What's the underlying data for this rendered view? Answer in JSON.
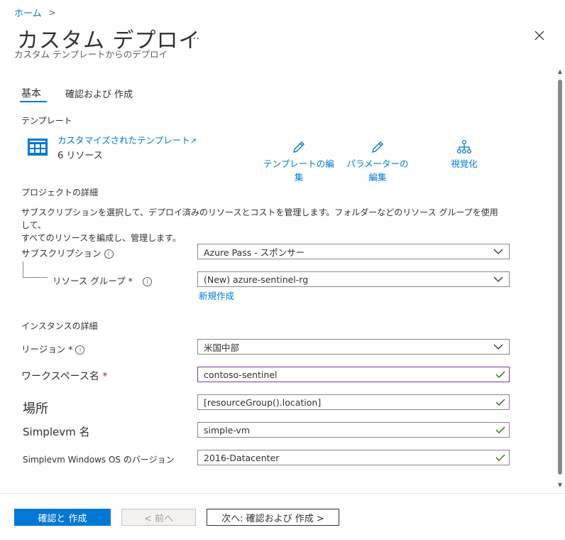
{
  "breadcrumb": {
    "home": "ホーム",
    "separator": ">"
  },
  "header": {
    "title": "カスタム デプロイ",
    "more": "...",
    "subtitle": "カスタム テンプレートからのデプロイ"
  },
  "tabs": [
    {
      "label": "基本"
    },
    {
      "label": "確認および 作成"
    }
  ],
  "template": {
    "section_label": "テンプレート",
    "link": "カスタマイズされたテンプレート",
    "count": "6 リソース",
    "actions": {
      "edit_template": "テンプレートの編集",
      "edit_params": "パラメーターの編集",
      "visualize": "視覚化"
    }
  },
  "project": {
    "section_label": "プロジェクトの詳細",
    "description_line1": "サブスクリプションを選択して、デプロイ済みのリソースとコストを管理します。フォルダーなどのリソース グループを使用して、",
    "description_line2": "すべてのリソースを編成し、管理します。",
    "subscription_label": "サブスクリプション",
    "subscription_value": "Azure Pass - スポンサー",
    "rg_label": "リソース グループ *",
    "rg_value": "(New) azure-sentinel-rg",
    "create_new": "新規作成"
  },
  "instance": {
    "section_label": "インスタンスの詳細",
    "region_label": "リージョン *",
    "region_value": "米国中部",
    "workspace_label": "ワークスペース名",
    "workspace_required": "*",
    "workspace_value": "contoso-sentinel",
    "location_label": "場所",
    "location_value": "[resourceGroup().location]",
    "vm_name_label": "Simplevm 名",
    "vm_name_value": "simple-vm",
    "os_label": "Simplevm Windows OS のバージョン",
    "os_value": "2016-Datacenter"
  },
  "footer": {
    "review_create": "確認と 作成",
    "previous": "< 前へ",
    "next": "次へ: 確認および 作成 >"
  },
  "colors": {
    "accent": "#0078d4",
    "success": "#107c10",
    "required": "#a4262c",
    "focus_border": "#7a3a9e"
  }
}
